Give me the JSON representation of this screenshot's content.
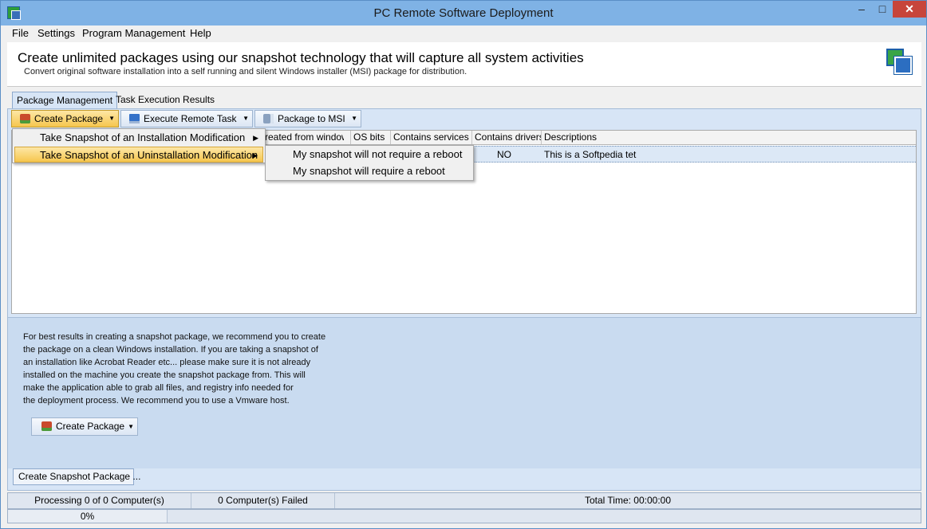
{
  "window": {
    "title": "PC Remote Software Deployment",
    "minimize": "–",
    "maximize": "□",
    "close": "✕"
  },
  "menubar": {
    "file": "File",
    "settings": "Settings",
    "program_management": "Program Management",
    "help": "Help"
  },
  "banner": {
    "headline": "Create unlimited packages using our snapshot technology that will capture all system activities",
    "subtitle": "Convert original software installation into a self running and silent Windows installer (MSI) package for distribution."
  },
  "tabs": {
    "package_management": "Package Management",
    "task_results": "Task Execution Results"
  },
  "toolbar": {
    "create_package": "Create Package",
    "execute_remote": "Execute Remote Task",
    "package_to_msi": "Package to MSI"
  },
  "grid": {
    "columns": [
      "reated from windows",
      "OS bits",
      "Contains services",
      "Contains drivers",
      "Descriptions"
    ],
    "row": {
      "contains_drivers": "NO",
      "description": "This is a Softpedia tet"
    }
  },
  "menu1": {
    "install_mod": "Take Snapshot of an Installation Modification",
    "uninstall_mod": "Take Snapshot of an Uninstallation Modification"
  },
  "menu2": {
    "no_reboot": "My snapshot will not require a reboot",
    "reboot": "My snapshot will require a reboot"
  },
  "info": {
    "lines": [
      "For best results in creating a snapshot package, we recommend you to create",
      "the package on a clean Windows installation. If you are taking a snapshot of",
      "an installation like Acrobat Reader etc... please make sure it is not already",
      "installed on the machine you create the snapshot package from. This will",
      "make the application able to grab all files, and registry info needed for",
      "the deployment process. We recommend you to use a Vmware host."
    ],
    "create_button": "Create Package",
    "bottom_tab": "Create Snapshot Package ..."
  },
  "status": {
    "processing": "Processing 0 of 0 Computer(s)",
    "failed": "0 Computer(s) Failed",
    "total_time": "Total Time: 00:00:00",
    "progress_text": "0%",
    "progress_value": 0
  }
}
